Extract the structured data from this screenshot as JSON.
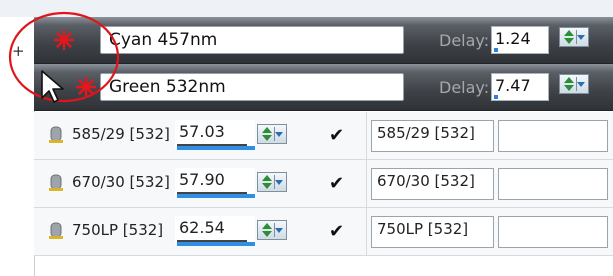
{
  "lasers": [
    {
      "name": "Cyan 457nm",
      "delay_label": "Delay:",
      "delay_value": "1.24",
      "delay_level": 0.08,
      "icon": "laser-star-icon",
      "color": "#e8151b"
    },
    {
      "name": "Green 532nm",
      "delay_label": "Delay:",
      "delay_value": "7.47",
      "delay_level": 0.08,
      "icon": "laser-star-icon",
      "color": "#e8151b"
    }
  ],
  "expand_symbol": "+",
  "filters": [
    {
      "name": "585/29 [532]",
      "value": "57.03",
      "level": 1.0,
      "checked": "✔",
      "description": "585/29 [532]",
      "extra": "",
      "icon": "filter-icon"
    },
    {
      "name": "670/30 [532]",
      "value": "57.90",
      "level": 1.0,
      "checked": "✔",
      "description": "670/30 [532]",
      "extra": "",
      "icon": "filter-icon"
    },
    {
      "name": "750LP [532]",
      "value": "62.54",
      "level": 1.0,
      "checked": "✔",
      "description": "750LP [532]",
      "extra": "",
      "icon": "filter-icon"
    }
  ],
  "colors": {
    "accent_blue": "#2f8ee6",
    "spin_green": "#2a8f34",
    "annotation_red": "#e0141b"
  }
}
